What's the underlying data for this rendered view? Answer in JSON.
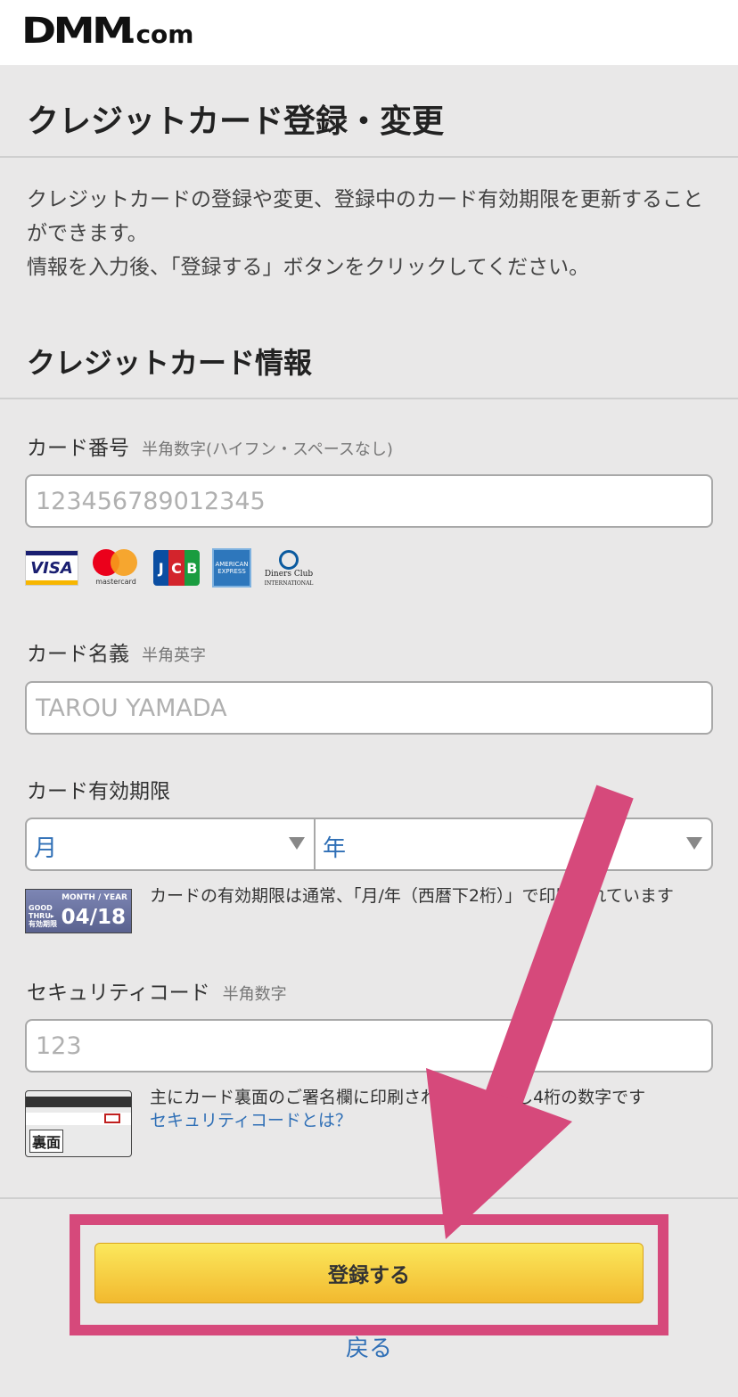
{
  "header": {
    "logo_main": "DMM",
    "logo_suffix": ".com"
  },
  "page": {
    "title": "クレジットカード登録・変更",
    "description_line1": "クレジットカードの登録や変更、登録中のカード有効期限を更新することができます。",
    "description_line2": "情報を入力後、「登録する」ボタンをクリックしてください。"
  },
  "section": {
    "title": "クレジットカード情報"
  },
  "card_number": {
    "label": "カード番号",
    "hint": "半角数字(ハイフン・スペースなし)",
    "placeholder": "123456789012345",
    "value": ""
  },
  "brands": {
    "visa": "VISA",
    "mastercard": "mastercard",
    "jcb": [
      "J",
      "C",
      "B"
    ],
    "amex_top": "AMERICAN",
    "amex_bottom": "EXPRESS",
    "diners_line1": "Diners Club",
    "diners_line2": "INTERNATIONAL"
  },
  "card_name": {
    "label": "カード名義",
    "hint": "半角英字",
    "placeholder": "TAROU YAMADA",
    "value": ""
  },
  "expiry": {
    "label": "カード有効期限",
    "month_selected": "月",
    "year_selected": "年",
    "sample_top": "MONTH / YEAR",
    "sample_left": "GOOD THRU▸ 有効期限",
    "sample_date": "04/18",
    "help": "カードの有効期限は通常、「月/年（西暦下2桁）」で印刷されています"
  },
  "security_code": {
    "label": "セキュリティコード",
    "hint": "半角数字",
    "placeholder": "123",
    "value": "",
    "card_back_label": "裏面",
    "help": "主にカード裏面のご署名欄に印刷された3桁ないし4桁の数字です",
    "help_link": "セキュリティコードとは？"
  },
  "actions": {
    "submit_label": "登録する",
    "back_label": "戻る"
  },
  "colors": {
    "highlight": "#d6497b",
    "link": "#2f6fb6",
    "button_top": "#fbe85c",
    "button_bottom": "#f2b92f"
  }
}
